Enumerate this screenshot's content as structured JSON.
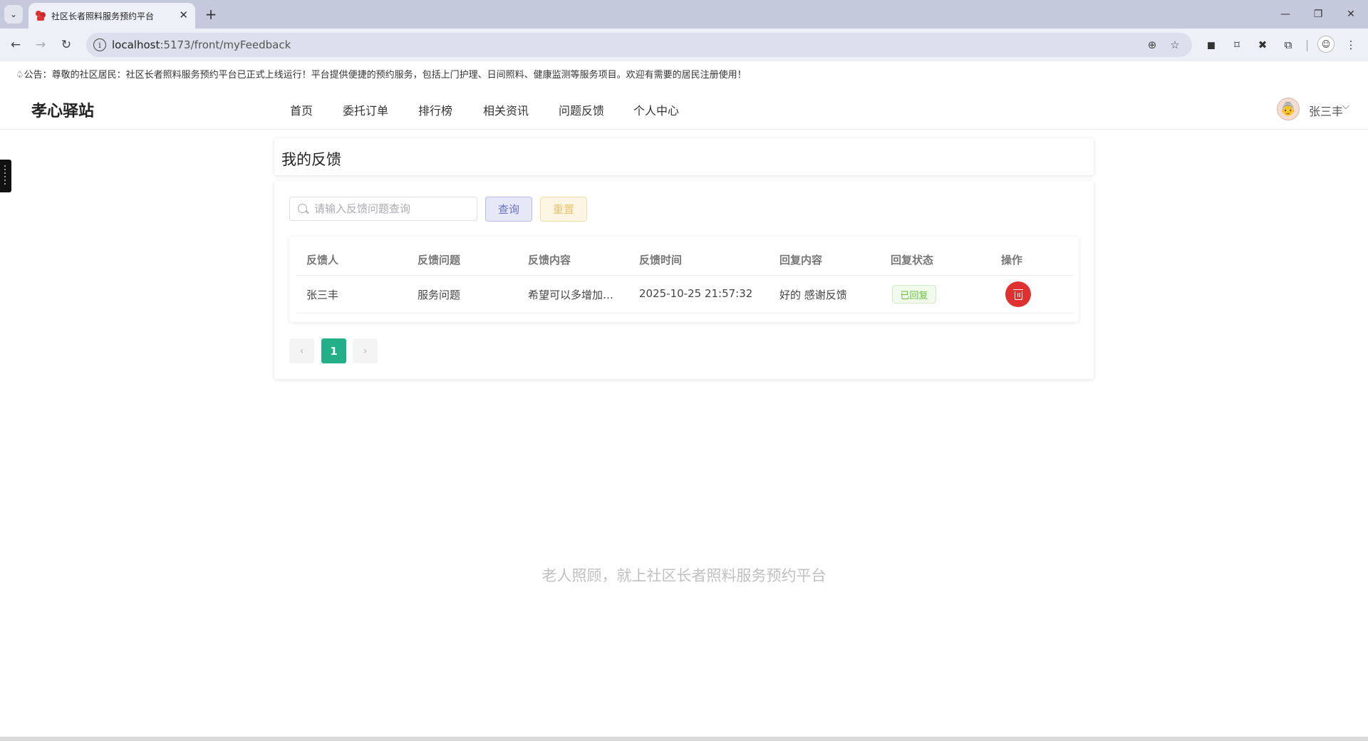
{
  "browser": {
    "tab_title": "社区长者照料服务预约平台",
    "url_host": "localhost",
    "url_path": ":5173/front/myFeedback"
  },
  "page": {
    "notice": "公告：尊敬的社区居民：社区长者照料服务预约平台已正式上线运行！平台提供便捷的预约服务，包括上门护理、日间照料、健康监测等服务项目。欢迎有需要的居民注册使用！",
    "brand": "孝心驿站",
    "nav": [
      "首页",
      "委托订单",
      "排行榜",
      "相关资讯",
      "问题反馈",
      "个人中心"
    ],
    "user_name": "张三丰",
    "section_title": "我的反馈",
    "search": {
      "placeholder": "请输入反馈问题查询",
      "value": ""
    },
    "buttons": {
      "query": "查询",
      "reset": "重置"
    },
    "table": {
      "headers": [
        "反馈人",
        "反馈问题",
        "反馈内容",
        "反馈时间",
        "回复内容",
        "回复状态",
        "操作"
      ],
      "rows": [
        {
          "user": "张三丰",
          "question": "服务问题",
          "content": "希望可以多增加…",
          "time": "2025-10-25 21:57:32",
          "reply": "好的 感谢反馈",
          "status": "已回复"
        }
      ]
    },
    "pagination": {
      "prev": "‹",
      "current": "1",
      "next": "›"
    },
    "slogan": "老人照顾，就上社区长者照料服务预约平台"
  },
  "colors": {
    "primary_page": "#23b089",
    "delete": "#e03131",
    "status_success": "#67c23a",
    "query_button": "#6b70c8",
    "reset_button": "#e9c46d"
  },
  "icons": {
    "tab_favicon": "elder-care-icon",
    "search": "search-icon",
    "delete": "trash-icon",
    "user_menu": "chevron-down-icon"
  }
}
